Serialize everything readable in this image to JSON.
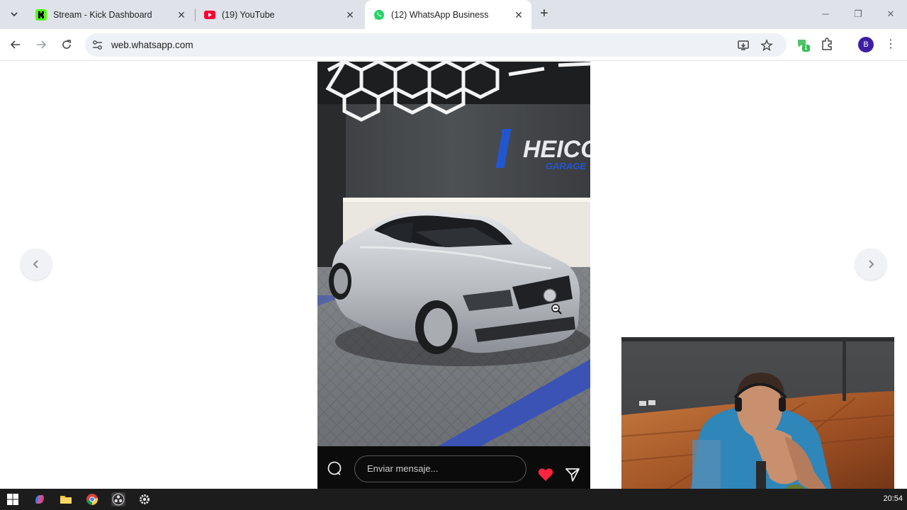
{
  "browser": {
    "tabs": [
      {
        "title": "Stream - Kick Dashboard",
        "active": false
      },
      {
        "title": "(19) YouTube",
        "active": false
      },
      {
        "title": "(12) WhatsApp Business",
        "active": true
      }
    ],
    "url": "web.whatsapp.com",
    "profile_initial": "B",
    "extension_badge": "1"
  },
  "viewer": {
    "message_placeholder": "Enviar mensaje...",
    "prev_icon": "chevron-left-icon",
    "next_icon": "chevron-right-icon"
  },
  "taskbar": {
    "clock": "20:54",
    "icons": [
      "windows-start-icon",
      "copilot-icon",
      "file-explorer-icon",
      "chrome-icon",
      "obs-icon",
      "settings-icon"
    ]
  },
  "colors": {
    "kick_green": "#53fc18",
    "youtube_red": "#ff0033",
    "whatsapp_green": "#25d366",
    "heart_red": "#ff2440",
    "profile_purple": "#3c1ea5"
  }
}
